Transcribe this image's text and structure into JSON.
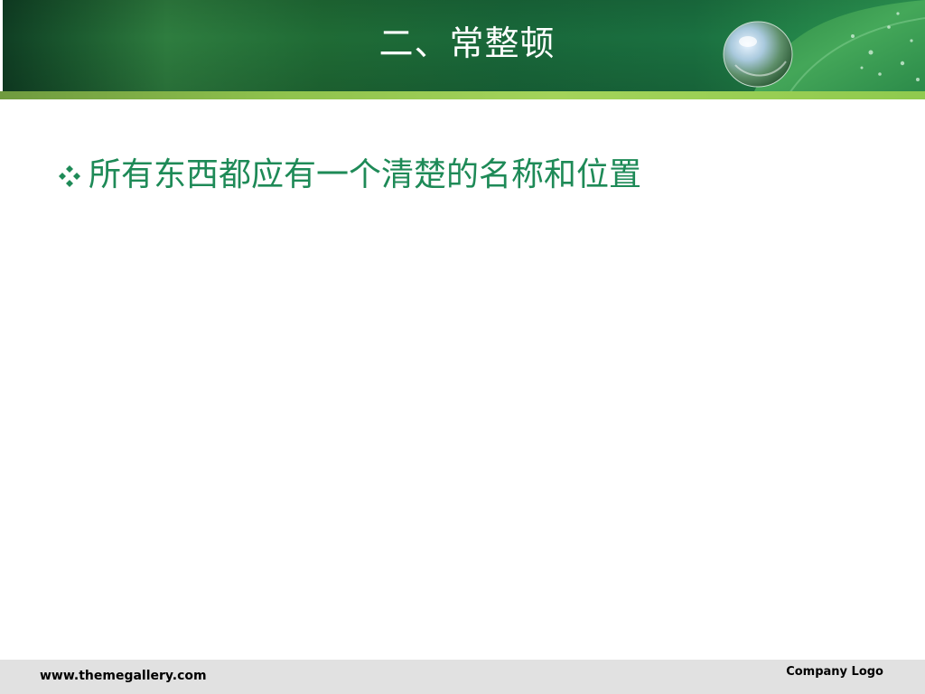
{
  "slide": {
    "title": "二、常整顿",
    "bullet": {
      "icon": "diamond-bullet-icon",
      "text": "所有东西都应有一个清楚的名称和位置"
    },
    "footer": {
      "url": "www.themegallery.com",
      "logo": "Company Logo"
    }
  },
  "colors": {
    "header_green": "#1f6b35",
    "accent_strip": "#a4d35a",
    "bullet_text": "#1e8a57",
    "footer_bg": "#e1e1e1"
  }
}
